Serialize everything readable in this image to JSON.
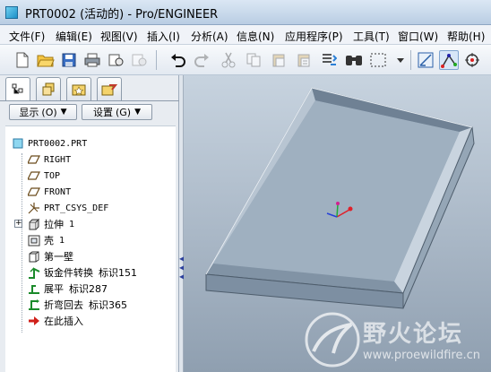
{
  "window": {
    "title": "PRT0002 (活动的) - Pro/ENGINEER"
  },
  "menu": [
    "文件(F)",
    "编辑(E)",
    "视图(V)",
    "插入(I)",
    "分析(A)",
    "信息(N)",
    "应用程序(P)",
    "工具(T)",
    "窗口(W)",
    "帮助(H)"
  ],
  "toolbar": {
    "icons": [
      "new-file-icon",
      "open-folder-icon",
      "save-icon",
      "print-icon",
      "send-email-icon",
      "regenerate-icon",
      "undo-icon",
      "redo-icon",
      "cut-icon",
      "copy-icon",
      "paste-icon",
      "paste-special-icon",
      "regenerate-model-icon",
      "find-icon",
      "select-box-icon",
      "named-view-icon",
      "datum-axis-icon",
      "spin-center-icon"
    ]
  },
  "leftpane": {
    "tabs": [
      "model-tree-tab",
      "layers-tab",
      "favorites-tab",
      "connections-tab"
    ],
    "show_button": "显示",
    "show_key": "(O)",
    "settings_button": "设置",
    "settings_key": "(G)"
  },
  "tree": {
    "root": "PRT0002.PRT",
    "items": [
      {
        "label": "RIGHT",
        "extra": "",
        "icon": "datum-plane-icon",
        "mono": true
      },
      {
        "label": "TOP",
        "extra": "",
        "icon": "datum-plane-icon",
        "mono": true
      },
      {
        "label": "FRONT",
        "extra": "",
        "icon": "datum-plane-icon",
        "mono": true
      },
      {
        "label": "PRT_CSYS_DEF",
        "extra": "",
        "icon": "csys-icon",
        "mono": true
      },
      {
        "label": "拉伸",
        "extra": "1",
        "icon": "extrude-icon",
        "mono": false
      },
      {
        "label": "壳",
        "extra": "1",
        "icon": "shell-icon",
        "mono": false
      },
      {
        "label": "第一壁",
        "extra": "",
        "icon": "first-wall-icon",
        "mono": false
      },
      {
        "label": "钣金件转换",
        "extra": "标识151",
        "icon": "sheetmetal-convert-icon",
        "mono": false
      },
      {
        "label": "展平",
        "extra": "标识287",
        "icon": "unbend-icon",
        "mono": false
      },
      {
        "label": "折弯回去",
        "extra": "标识365",
        "icon": "bend-back-icon",
        "mono": false
      },
      {
        "label": "在此插入",
        "extra": "",
        "icon": "insert-here-arrow-icon",
        "mono": false
      }
    ]
  },
  "watermark": {
    "text": "野火论坛",
    "url": "www.proewildfire.cn"
  },
  "colors": {
    "tray": "#9fb0c0",
    "tray_dark": "#6f8194",
    "viewport_top": "#c7d3df",
    "csys_red": "#e0202a",
    "csys_green": "#1faa3a",
    "csys_blue": "#2540d8"
  }
}
